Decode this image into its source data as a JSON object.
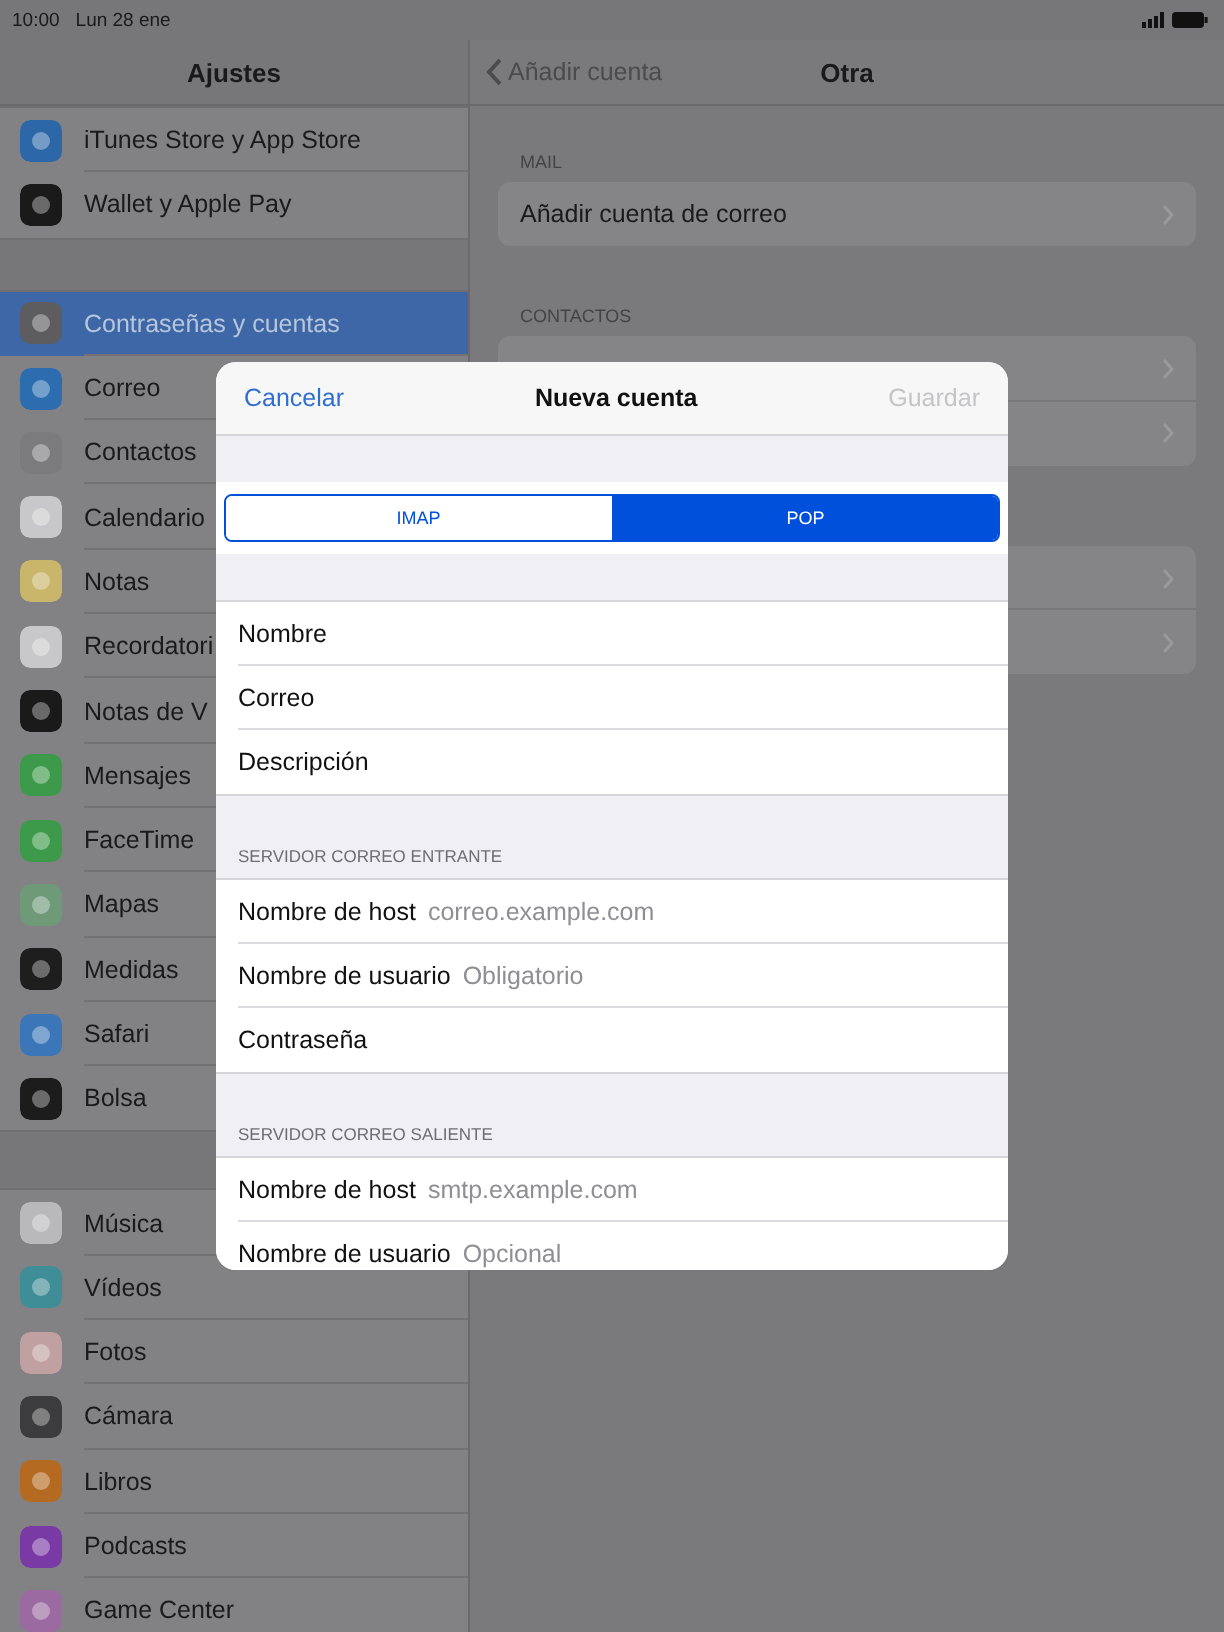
{
  "status_bar": {
    "time": "10:00",
    "date": "Lun 28 ene"
  },
  "sidebar": {
    "title": "Ajustes",
    "groups": [
      [
        {
          "label": "iTunes Store y App Store",
          "selected": false
        },
        {
          "label": "Wallet y Apple Pay",
          "selected": false
        }
      ],
      [
        {
          "label": "Contraseñas y cuentas",
          "selected": true
        },
        {
          "label": "Correo",
          "selected": false
        },
        {
          "label": "Contactos",
          "selected": false
        },
        {
          "label": "Calendario",
          "selected": false
        },
        {
          "label": "Notas",
          "selected": false
        },
        {
          "label": "Recordatori",
          "selected": false
        },
        {
          "label": "Notas de V",
          "selected": false
        },
        {
          "label": "Mensajes",
          "selected": false
        },
        {
          "label": "FaceTime",
          "selected": false
        },
        {
          "label": "Mapas",
          "selected": false
        },
        {
          "label": "Medidas",
          "selected": false
        },
        {
          "label": "Safari",
          "selected": false
        },
        {
          "label": "Bolsa",
          "selected": false
        }
      ],
      [
        {
          "label": "Música",
          "selected": false
        },
        {
          "label": "Vídeos",
          "selected": false
        },
        {
          "label": "Fotos",
          "selected": false
        },
        {
          "label": "Cámara",
          "selected": false
        },
        {
          "label": "Libros",
          "selected": false
        },
        {
          "label": "Podcasts",
          "selected": false
        },
        {
          "label": "Game Center",
          "selected": false
        }
      ]
    ]
  },
  "detail": {
    "back": "Añadir cuenta",
    "title": "Otra",
    "sections": [
      {
        "header": "MAIL",
        "rows": [
          {
            "kind": "link",
            "label": "Añadir cuenta de correo"
          }
        ]
      },
      {
        "header": "CONTACTOS",
        "rows": [
          {
            "kind": "link"
          },
          {
            "kind": "link"
          }
        ]
      },
      {
        "rows": [
          {
            "kind": "link"
          },
          {
            "kind": "link"
          }
        ]
      }
    ]
  },
  "sheet": {
    "cancel": "Cancelar",
    "title": "Nueva cuenta",
    "save": {
      "label": "Guardar",
      "disabled": true
    },
    "segments": [
      {
        "label": "IMAP",
        "selected": false
      },
      {
        "label": "POP",
        "selected": true
      }
    ],
    "groups": [
      {
        "fields": [
          {
            "label": "Nombre"
          },
          {
            "label": "Correo"
          },
          {
            "label": "Descripción"
          }
        ]
      },
      {
        "header": "SERVIDOR CORREO ENTRANTE",
        "fields": [
          {
            "label": "Nombre de host",
            "placeholder": "correo.example.com"
          },
          {
            "label": "Nombre de usuario",
            "placeholder": "Obligatorio"
          },
          {
            "label": "Contraseña"
          }
        ]
      },
      {
        "header": "SERVIDOR CORREO SALIENTE",
        "fields": [
          {
            "label": "Nombre de host",
            "placeholder": "smtp.example.com"
          },
          {
            "label": "Nombre de usuario",
            "placeholder": "Opcional"
          }
        ]
      }
    ]
  }
}
